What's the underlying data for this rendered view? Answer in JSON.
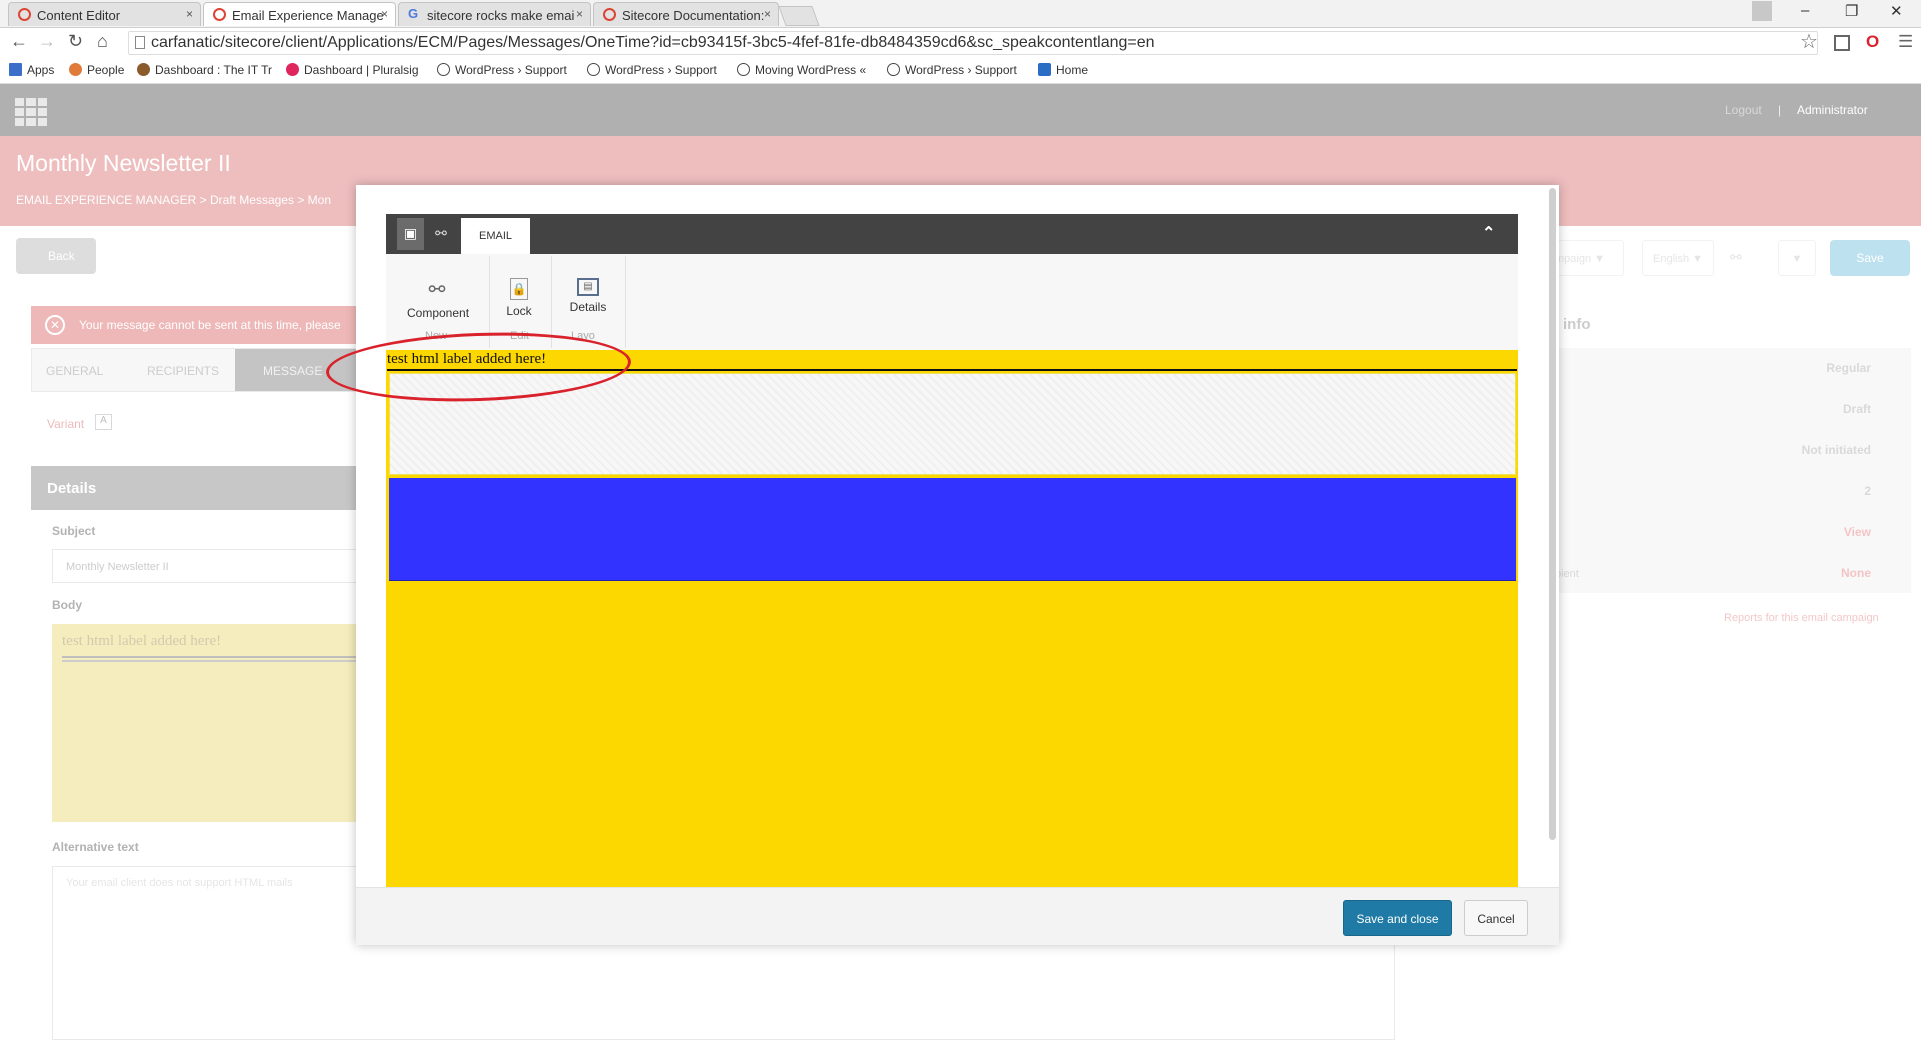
{
  "browser": {
    "tabs": [
      {
        "label": "Content Editor",
        "close": "×"
      },
      {
        "label": "Email Experience Manage",
        "close": "×"
      },
      {
        "label": "sitecore rocks make emai",
        "close": "×"
      },
      {
        "label": "Sitecore Documentation: ",
        "close": "×"
      }
    ],
    "window_controls": [
      "–",
      "❐",
      "✕"
    ],
    "url": "carfanatic/sitecore/client/Applications/ECM/Pages/Messages/OneTime?id=cb93415f-3bc5-4fef-81fe-db8484359cd6&sc_speakcontentlang=en",
    "bookmarks": [
      {
        "label": "Apps",
        "icon": "apps-grid-icon",
        "color": "#3b6fc9"
      },
      {
        "label": "People",
        "icon": "people-icon",
        "color": "#e07b3a"
      },
      {
        "label": "Dashboard : The IT Tr",
        "icon": "monkey-icon",
        "color": "#8a5a2b"
      },
      {
        "label": "Dashboard | Pluralsig",
        "icon": "pluralsight-icon",
        "color": "#e0245e"
      },
      {
        "label": "WordPress › Support",
        "icon": "wordpress-icon",
        "color": "#464646"
      },
      {
        "label": "WordPress › Support",
        "icon": "wordpress-icon",
        "color": "#464646"
      },
      {
        "label": "Moving WordPress «",
        "icon": "wordpress-icon",
        "color": "#464646"
      },
      {
        "label": "WordPress › Support",
        "icon": "wordpress-icon",
        "color": "#464646"
      },
      {
        "label": "Home",
        "icon": "home-c-icon",
        "color": "#2b6cc4"
      }
    ]
  },
  "app": {
    "logout": "Logout",
    "separator": "|",
    "user": "Administrator",
    "title": "Monthly Newsletter II",
    "breadcrumb": "EMAIL EXPERIENCE MANAGER   >   Draft Messages   >   Mon",
    "back": "Back",
    "error": "Your message cannot be sent at this time, please",
    "steps": [
      "GENERAL",
      "RECIPIENTS",
      "MESSAGE"
    ],
    "variant_label": "Variant",
    "variant_value": "A",
    "details_header": "Details",
    "subject_label": "Subject",
    "subject_value": "Monthly Newsletter II",
    "body_label": "Body",
    "body_preview": "test html label added here!",
    "alt_label": "Alternative text",
    "alt_placeholder": "Your email client does not support HTML mails",
    "right_buttons": {
      "campaign": "mpaign ▼",
      "language": "English ▼",
      "more": "▼",
      "save": "Save"
    },
    "info_title": "info",
    "info_values": [
      "Regular",
      "Draft",
      "Not initiated",
      "2",
      "View",
      "None"
    ],
    "info_recipient_label": "pient",
    "reports_link": "Reports for this email campaign"
  },
  "modal": {
    "ribbon_tab": "EMAIL",
    "collapse_icon": "⌃",
    "groups": [
      {
        "button": "Component",
        "group": "New",
        "icon": "component-icon"
      },
      {
        "button": "Lock",
        "group": "Edit",
        "icon": "lock-icon"
      },
      {
        "button": "Details",
        "group": "Layo",
        "icon": "details-icon"
      }
    ],
    "html_label": "test html label added here!",
    "save_close": "Save and close",
    "cancel": "Cancel",
    "colors": {
      "canvas": "#fcd700",
      "blue_row": "#3333ff",
      "annotation": "#d9222b",
      "primary": "#1f7aa5"
    }
  }
}
